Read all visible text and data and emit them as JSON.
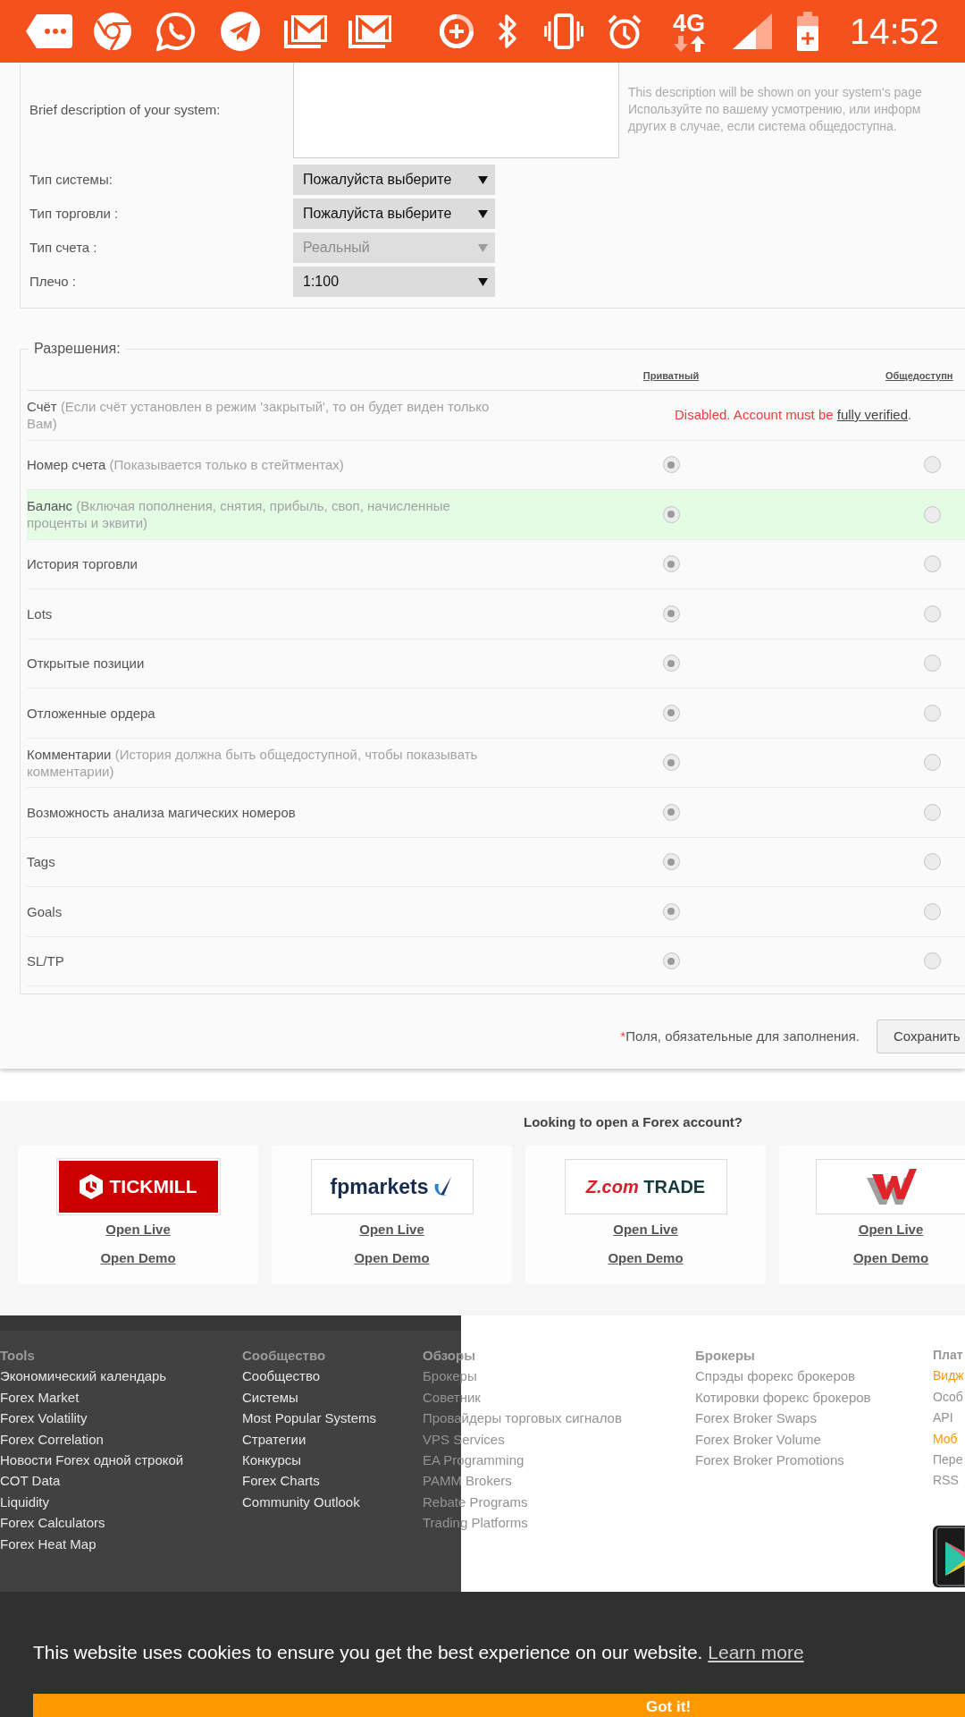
{
  "status_bar": {
    "network_type": "4G",
    "time": "14:52"
  },
  "system_form": {
    "description": {
      "label": "Brief description of your system:",
      "help_lines": [
        "This description will be shown on your system's page",
        "Используйте по вашему усмотрению, или информ",
        "других в случае, если система общедоступна."
      ]
    },
    "fields": [
      {
        "label": "Тип системы:",
        "value": "Пожалуйста выберите",
        "disabled": false
      },
      {
        "label": "Тип торговли :",
        "value": "Пожалуйста выберите",
        "disabled": false
      },
      {
        "label": "Тип счета :",
        "value": "Реальный",
        "disabled": true
      },
      {
        "label": "Плечо :",
        "value": "1:100",
        "disabled": false
      }
    ]
  },
  "permissions": {
    "legend": "Разрешения:",
    "columns": [
      "Приватный",
      "Общедоступн"
    ],
    "rows": [
      {
        "kind": "message",
        "label": "Счёт",
        "note": "(Если счёт установлен в режим 'закрытый', то он будет виден только Вам)",
        "highlighted": false,
        "message": {
          "text": "Disabled. Account must be",
          "link": "fully verified",
          "end": "."
        }
      },
      {
        "kind": "radios",
        "label": "Номер счета",
        "note": "(Показывается только в стейтментах)",
        "highlighted": false,
        "options": [
          {
            "selected": true
          },
          {
            "selected": false
          }
        ]
      },
      {
        "kind": "radios",
        "label": "Баланс",
        "note": "(Включая пополнения, снятия, прибыль, своп, начисленные проценты и эквити)",
        "highlighted": true,
        "options": [
          {
            "selected": true
          },
          {
            "selected": false
          }
        ]
      },
      {
        "kind": "radios",
        "label": "История торговли",
        "highlighted": false,
        "options": [
          {
            "selected": true
          },
          {
            "selected": false
          }
        ]
      },
      {
        "kind": "radios",
        "label": "Lots",
        "highlighted": false,
        "options": [
          {
            "selected": true
          },
          {
            "selected": false
          }
        ]
      },
      {
        "kind": "radios",
        "label": "Открытые позиции",
        "highlighted": false,
        "options": [
          {
            "selected": true
          },
          {
            "selected": false
          }
        ]
      },
      {
        "kind": "radios",
        "label": "Отложенные ордера",
        "highlighted": false,
        "options": [
          {
            "selected": true
          },
          {
            "selected": false
          }
        ]
      },
      {
        "kind": "radios",
        "label": "Комментарии",
        "note": "(История должна быть общедоступной, чтобы показывать комментарии)",
        "highlighted": false,
        "options": [
          {
            "selected": true
          },
          {
            "selected": false
          }
        ]
      },
      {
        "kind": "radios",
        "label": "Возможность анализа магических номеров",
        "highlighted": false,
        "options": [
          {
            "selected": true
          },
          {
            "selected": false
          }
        ]
      },
      {
        "kind": "radios",
        "label": "Tags",
        "highlighted": false,
        "options": [
          {
            "selected": true
          },
          {
            "selected": false
          }
        ]
      },
      {
        "kind": "radios",
        "label": "Goals",
        "highlighted": false,
        "options": [
          {
            "selected": true
          },
          {
            "selected": false
          }
        ]
      },
      {
        "kind": "radios",
        "label": "SL/TP",
        "highlighted": false,
        "options": [
          {
            "selected": true
          },
          {
            "selected": false
          }
        ]
      }
    ]
  },
  "required_note": {
    "mark": "*",
    "text": "Поля, обязательные для заполнения."
  },
  "save_button": "Сохранить",
  "brokers": {
    "title": "Looking to open a Forex account?",
    "items": [
      {
        "logo": {
          "kind": "tickmill",
          "text": "TICKMILL"
        },
        "links": [
          "Open Live",
          "Open Demo"
        ]
      },
      {
        "logo": {
          "kind": "fpmarkets",
          "text": "fpmarkets"
        },
        "links": [
          "Open Live",
          "Open Demo"
        ]
      },
      {
        "logo": {
          "kind": "zcom",
          "text": "Z.com",
          "text_2": "TRADE"
        },
        "links": [
          "Open Live",
          "Open Demo"
        ]
      },
      {
        "logo": {
          "kind": "mark"
        },
        "links": [
          "Open Live",
          "Open Demo"
        ]
      }
    ]
  },
  "footer": {
    "columns": [
      {
        "title": "Tools",
        "links": [
          {
            "label": "Экономический календарь"
          },
          {
            "label": "Forex Market"
          },
          {
            "label": "Forex Volatility"
          },
          {
            "label": "Forex Correlation"
          },
          {
            "label": "Новости Forex одной строкой"
          },
          {
            "label": "COT Data"
          },
          {
            "label": "Liquidity"
          },
          {
            "label": "Forex Calculators"
          },
          {
            "label": "Forex Heat Map"
          }
        ]
      },
      {
        "title": "Сообщество",
        "links": [
          {
            "label": "Сообщество"
          },
          {
            "label": "Системы"
          },
          {
            "label": "Most Popular Systems"
          },
          {
            "label": "Стратегии"
          },
          {
            "label": "Конкурсы"
          },
          {
            "label": "Forex Charts"
          },
          {
            "label": "Community Outlook"
          }
        ]
      },
      {
        "title": "Обзоры",
        "links": [
          {
            "label": "Брокеры"
          },
          {
            "label": "Советник"
          },
          {
            "label": "Провайдеры торговых сигналов"
          },
          {
            "label": "VPS Services"
          },
          {
            "label": "EA Programming"
          },
          {
            "label": "PAMM Brokers"
          },
          {
            "label": "Rebate Programs"
          },
          {
            "label": "Trading Platforms"
          }
        ]
      },
      {
        "title": "Брокеры",
        "links": [
          {
            "label": "Спрэды форекс брокеров"
          },
          {
            "label": "Котировки форекс брокеров"
          },
          {
            "label": "Forex Broker Swaps"
          },
          {
            "label": "Forex Broker Volume"
          },
          {
            "label": "Forex Broker Promotions"
          }
        ]
      },
      {
        "title": "Плат",
        "links": [
          {
            "label": "Видж",
            "highlighted": true
          },
          {
            "label": "Особ",
            "highlighted": false
          },
          {
            "label": "API",
            "highlighted": false
          },
          {
            "label": "Моб",
            "highlighted": true
          },
          {
            "label": "Пере",
            "highlighted": false
          },
          {
            "label": "RSS",
            "highlighted": false
          }
        ]
      }
    ]
  },
  "cookie_banner": {
    "message": "This website uses cookies to ensure you get the best experience on our website.",
    "link": "Learn more",
    "button": "Got it!"
  }
}
